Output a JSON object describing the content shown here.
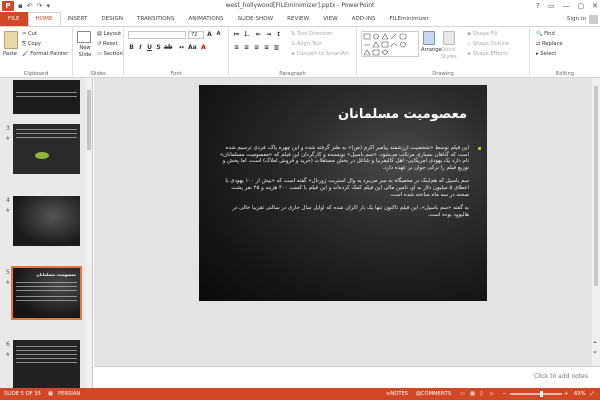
{
  "window": {
    "title": "west_hollywood[FILEminimizer].pptx - PowerPoint",
    "app_icon": "P",
    "controls": [
      "?",
      "▭",
      "—",
      "▢",
      "✕"
    ]
  },
  "tabs": [
    "FILE",
    "HOME",
    "INSERT",
    "DESIGN",
    "TRANSITIONS",
    "ANIMATIONS",
    "SLIDE SHOW",
    "REVIEW",
    "VIEW",
    "ADD-INS",
    "FILEminimizer"
  ],
  "active_tab": "HOME",
  "signin": "Sign in",
  "ribbon": {
    "clipboard": {
      "label": "Clipboard",
      "paste": "Paste",
      "cut": "Cut",
      "copy": "Copy",
      "format_painter": "Format Painter"
    },
    "slides": {
      "label": "Slides",
      "new_slide": "New Slide",
      "layout": "Layout",
      "reset": "Reset",
      "section": "Section"
    },
    "font": {
      "label": "Font",
      "size": "72"
    },
    "paragraph": {
      "label": "Paragraph",
      "text_direction": "Text Direction",
      "align_text": "Align Text",
      "convert": "Convert to SmartArt"
    },
    "drawing": {
      "label": "Drawing",
      "arrange": "Arrange",
      "quick_styles": "Quick Styles",
      "shape_fill": "Shape Fill",
      "shape_outline": "Shape Outline",
      "shape_effects": "Shape Effects"
    },
    "editing": {
      "label": "Editing",
      "find": "Find",
      "replace": "Replace",
      "select": "Select"
    }
  },
  "thumbnails": [
    {
      "num": "3",
      "star": "★"
    },
    {
      "num": "4",
      "star": "★"
    },
    {
      "num": "5",
      "star": "★",
      "title": "معصومیت مسلمانان"
    },
    {
      "num": "6",
      "star": "★"
    }
  ],
  "slide": {
    "title": "معصومیت مسلمانان",
    "paragraphs": [
      "این فیلم توسط «شخصیت ارزشمند پیامبر اکرم (ص)» به طنز گرفته شده و این چهره پاک، فردی ترسیم شده است که گناهان بسیاری مرتکب می‌شود. «سم باسیل» نویسنده و کارگردان این فیلم که «معصومیت مسلمانان» نام دارد یک یهودی امریکایی- اهل کالیفرنیا و شاغل در بخش مستغلات (خرید و فروش املاک) است، اما پخش و توزیع فیلم را ترکی جوان بر عهده دارد.",
      "سم باسیل که هم‌اینک در مخفیگاه به سر می‌برد به وال استریت ژورنال» گفته است که «بیش از ۱۰۰ یهودی با اعطای ۵ میلیون دلار به او، تامین مالی این فیلم کمک کرده‌اند و این فیلم با کسب ۴۰۰ هزینه و ۴۵ نفر پشت صحنه در سه ماه ساخته شده است.",
      "به گفته «سم باسیل»، این فیلم تاکنون تنها یک بار اکران شده که اوایل سال جاری در سالنی تقریبا خالی در هالیوود بوده است."
    ]
  },
  "notes_placeholder": "Click to add notes",
  "status": {
    "slide": "SLIDE 5 OF 35",
    "language": "PERSIAN",
    "notes": "NOTES",
    "comments": "COMMENTS",
    "zoom": "69%"
  },
  "colors": {
    "accent": "#d24726",
    "slide_bg": "#1a1a1a",
    "bullet": "#a7c64b",
    "thumb_selected": "#e6773b"
  }
}
